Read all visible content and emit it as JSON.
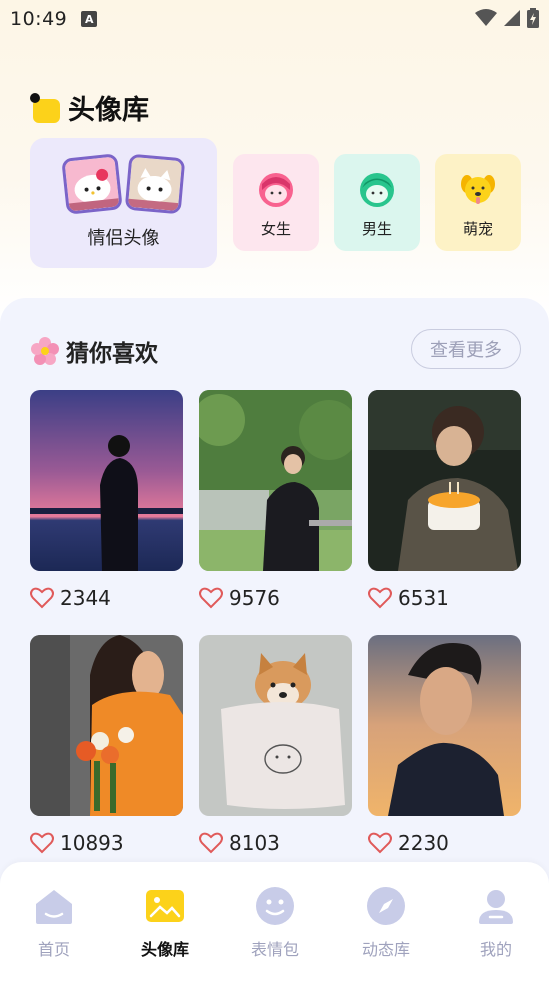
{
  "status": {
    "time": "10:49",
    "a_badge": "A"
  },
  "header": {
    "title": "头像库"
  },
  "categories": {
    "couple": "情侣头像",
    "female": "女生",
    "male": "男生",
    "pets": "萌宠"
  },
  "recommend": {
    "title": "猜你喜欢",
    "more": "查看更多",
    "items": [
      {
        "likes": "2344"
      },
      {
        "likes": "9576"
      },
      {
        "likes": "6531"
      },
      {
        "likes": "10893"
      },
      {
        "likes": "8103"
      },
      {
        "likes": "2230"
      }
    ]
  },
  "nav": {
    "items": [
      {
        "label": "首页"
      },
      {
        "label": "头像库"
      },
      {
        "label": "表情包"
      },
      {
        "label": "动态库"
      },
      {
        "label": "我的"
      }
    ]
  },
  "colors": {
    "accent_yellow": "#fcd21a",
    "couple_bg": "#ece9fb",
    "female_bg": "#fde6ee",
    "male_bg": "#dbf6ee",
    "pets_bg": "#fdf2c6",
    "panel_bg": "#f2f4fd",
    "heart": "#e05a5a",
    "nav_inactive": "#c8cce8"
  }
}
